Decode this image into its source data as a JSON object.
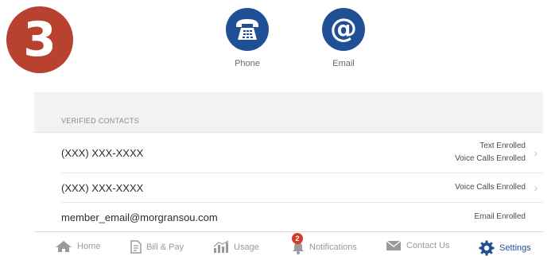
{
  "step_badge": "3",
  "methods": [
    {
      "label": "Phone",
      "icon": "telephone-icon"
    },
    {
      "label": "Email",
      "icon": "at-sign-icon"
    }
  ],
  "verified": {
    "header": "VERIFIED CONTACTS",
    "rows": [
      {
        "label": "(XXX) XXX-XXXX",
        "status": [
          "Text Enrolled",
          "Voice Calls Enrolled"
        ],
        "has_chevron": true
      },
      {
        "label": "(XXX) XXX-XXXX",
        "status": [
          "Voice Calls Enrolled"
        ],
        "has_chevron": true
      },
      {
        "label": "member_email@morgransou.com",
        "status": [
          "Email Enrolled"
        ],
        "has_chevron": false
      }
    ]
  },
  "tabbar": {
    "items": [
      {
        "label": "Home",
        "icon": "home-icon"
      },
      {
        "label": "Bill & Pay",
        "icon": "bill-icon"
      },
      {
        "label": "Usage",
        "icon": "usage-chart-icon"
      },
      {
        "label": "Notifications",
        "icon": "bell-icon",
        "badge": "2"
      },
      {
        "label": "Contact Us",
        "icon": "envelope-icon"
      },
      {
        "label": "Settings",
        "icon": "gear-icon",
        "active": true
      }
    ]
  },
  "colors": {
    "accent": "#1f4f95",
    "badge": "#b8412f",
    "notification": "#d63a2a"
  }
}
